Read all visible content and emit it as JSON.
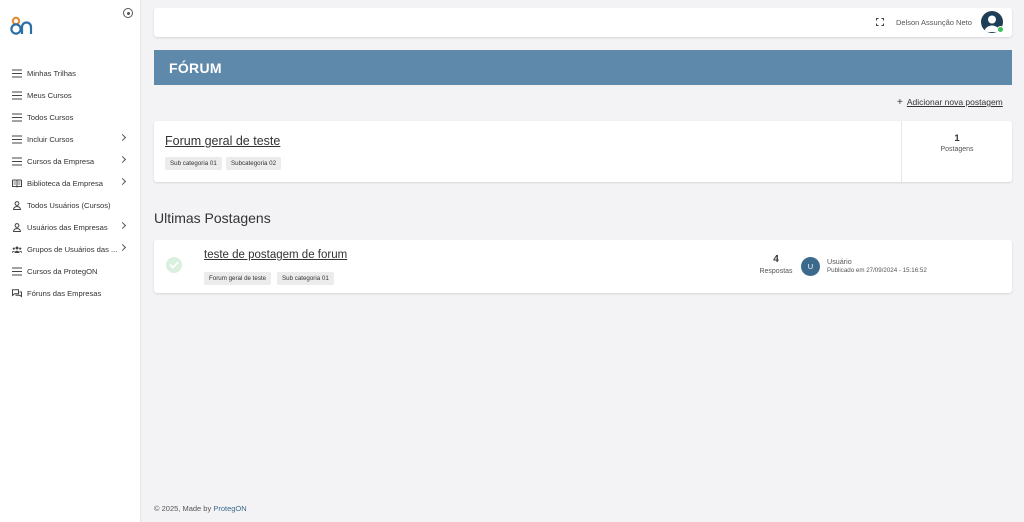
{
  "sidebar": {
    "items": [
      {
        "label": "Minhas Trilhas",
        "icon": "list-icon",
        "has_submenu": false
      },
      {
        "label": "Meus Cursos",
        "icon": "list-icon",
        "has_submenu": false
      },
      {
        "label": "Todos Cursos",
        "icon": "list-icon",
        "has_submenu": false
      },
      {
        "label": "Incluir Cursos",
        "icon": "list-icon",
        "has_submenu": true
      },
      {
        "label": "Cursos da Empresa",
        "icon": "list-icon",
        "has_submenu": true
      },
      {
        "label": "Biblioteca da Empresa",
        "icon": "book-icon",
        "has_submenu": true
      },
      {
        "label": "Todos Usuários (Cursos)",
        "icon": "user-icon",
        "has_submenu": false
      },
      {
        "label": "Usuários das Empresas",
        "icon": "user-icon",
        "has_submenu": true
      },
      {
        "label": "Grupos de Usuários das ...",
        "icon": "users-group-icon",
        "has_submenu": true
      },
      {
        "label": "Cursos da ProtegON",
        "icon": "list-icon",
        "has_submenu": false
      },
      {
        "label": "Fóruns das Empresas",
        "icon": "chat-icon",
        "has_submenu": false
      }
    ]
  },
  "header": {
    "user_name": "Delson Assunção Neto",
    "status_color": "#3cbf5a"
  },
  "banner": {
    "title": "FÓRUM",
    "color": "#5f89ab"
  },
  "actions": {
    "add_post_label": "Adicionar nova postagem"
  },
  "forum": {
    "title": "Forum geral de teste",
    "tags": [
      "Sub categoria 01",
      "Subcategoria 02"
    ],
    "post_count": "1",
    "post_count_label": "Postagens"
  },
  "latest": {
    "section_title": "Ultimas Postagens",
    "posts": [
      {
        "title": "teste de postagem de forum",
        "tags": [
          "Forum geral de teste",
          "Sub categoria 01"
        ],
        "replies": "4",
        "replies_label": "Respostas",
        "avatar_initial": "U",
        "author": "Usuário",
        "published": "Publicado em 27/09/2024 - 15:16:52"
      }
    ]
  },
  "footer": {
    "text": "© 2025, Made by ",
    "brand": "ProtegON"
  }
}
